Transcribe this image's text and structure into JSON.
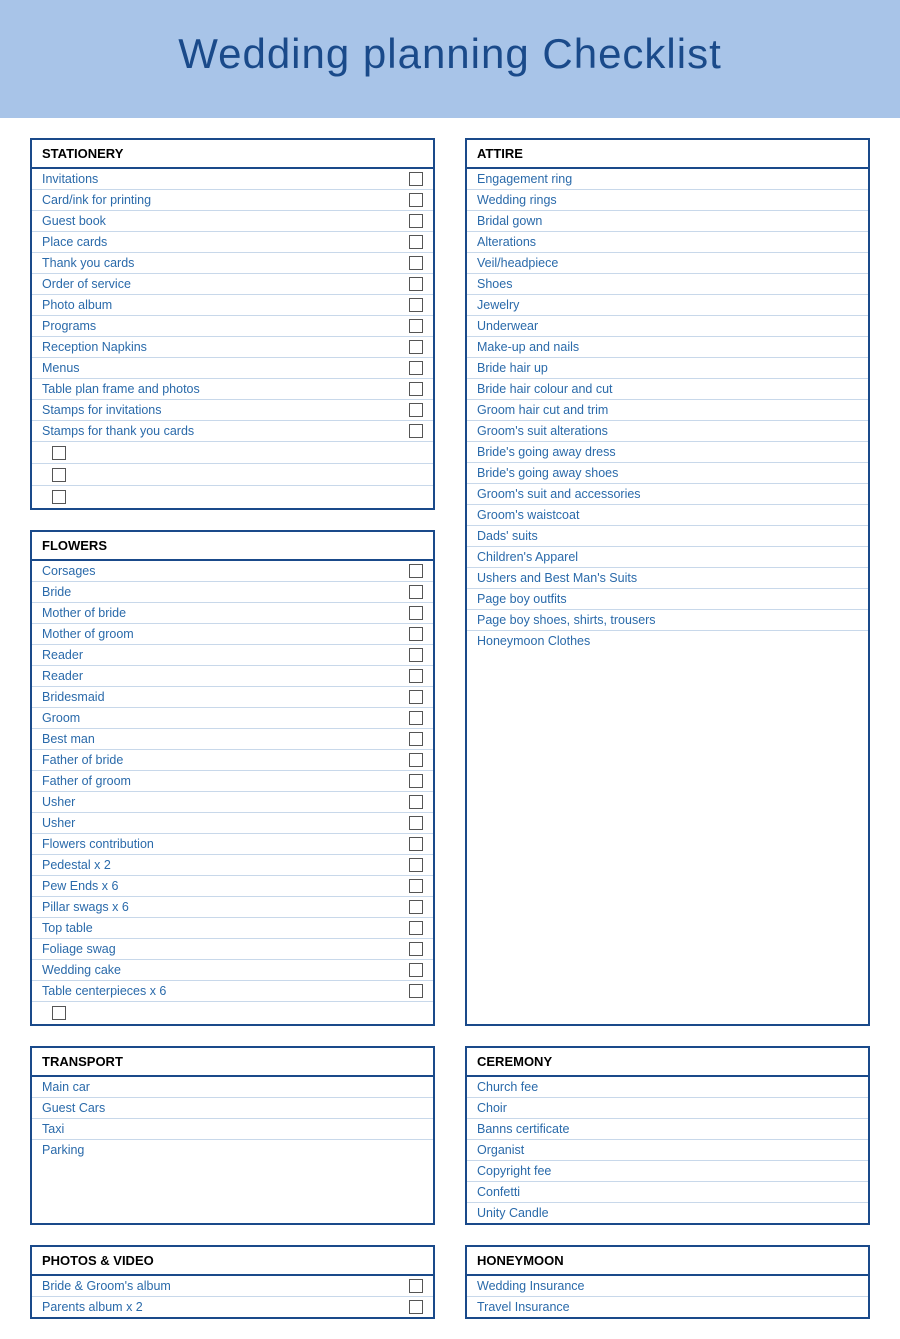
{
  "header": {
    "title": "Wedding planning Checklist"
  },
  "sections": {
    "stationery": {
      "title": "STATIONERY",
      "items": [
        "Invitations",
        "Card/ink for printing",
        "Guest book",
        "Place cards",
        "Thank you cards",
        "Order of service",
        "Photo album",
        "Programs",
        "Reception Napkins",
        "Menus",
        "Table plan frame and photos",
        "Stamps for invitations",
        "Stamps for thank you cards",
        "",
        "",
        ""
      ]
    },
    "attire": {
      "title": "ATTIRE",
      "items": [
        "Engagement ring",
        "Wedding rings",
        "Bridal gown",
        "Alterations",
        "Veil/headpiece",
        "Shoes",
        "Jewelry",
        "Underwear",
        "Make-up and nails",
        "Bride hair up",
        "Bride hair colour and cut",
        "Groom hair cut and trim",
        "Groom's suit alterations",
        "Bride's going away dress",
        "Bride's going away shoes",
        "Groom's suit and accessories",
        "Groom's waistcoat",
        "Dads' suits",
        "Children's Apparel",
        "Ushers and Best Man's Suits",
        "Page boy outfits",
        "Page boy shoes, shirts, trousers",
        "Honeymoon Clothes"
      ]
    },
    "flowers": {
      "title": "FLOWERS",
      "items": [
        "Corsages",
        "Bride",
        "Mother of bride",
        "Mother of groom",
        "Reader",
        "Reader",
        "Bridesmaid",
        "Groom",
        "Best man",
        "Father of bride",
        "Father of groom",
        "Usher",
        "Usher",
        "Flowers contribution",
        "Pedestal x 2",
        "Pew Ends x 6",
        "Pillar swags x 6",
        "Top table",
        "Foliage swag",
        "Wedding cake",
        "Table centerpieces x 6",
        ""
      ]
    },
    "transport": {
      "title": "TRANSPORT",
      "items": [
        "Main car",
        "Guest Cars",
        "Taxi",
        "Parking"
      ]
    },
    "ceremony": {
      "title": "CEREMONY",
      "items": [
        "Church fee",
        "Choir",
        "Banns certificate",
        "Organist",
        "Copyright fee",
        "Confetti",
        "Unity Candle"
      ]
    },
    "photos": {
      "title": "PHOTOS & VIDEO",
      "items": [
        "Bride & Groom's album",
        "Parents album x 2"
      ]
    },
    "honeymoon": {
      "title": "HONEYMOON",
      "items": [
        "Wedding Insurance",
        "Travel Insurance"
      ]
    }
  }
}
